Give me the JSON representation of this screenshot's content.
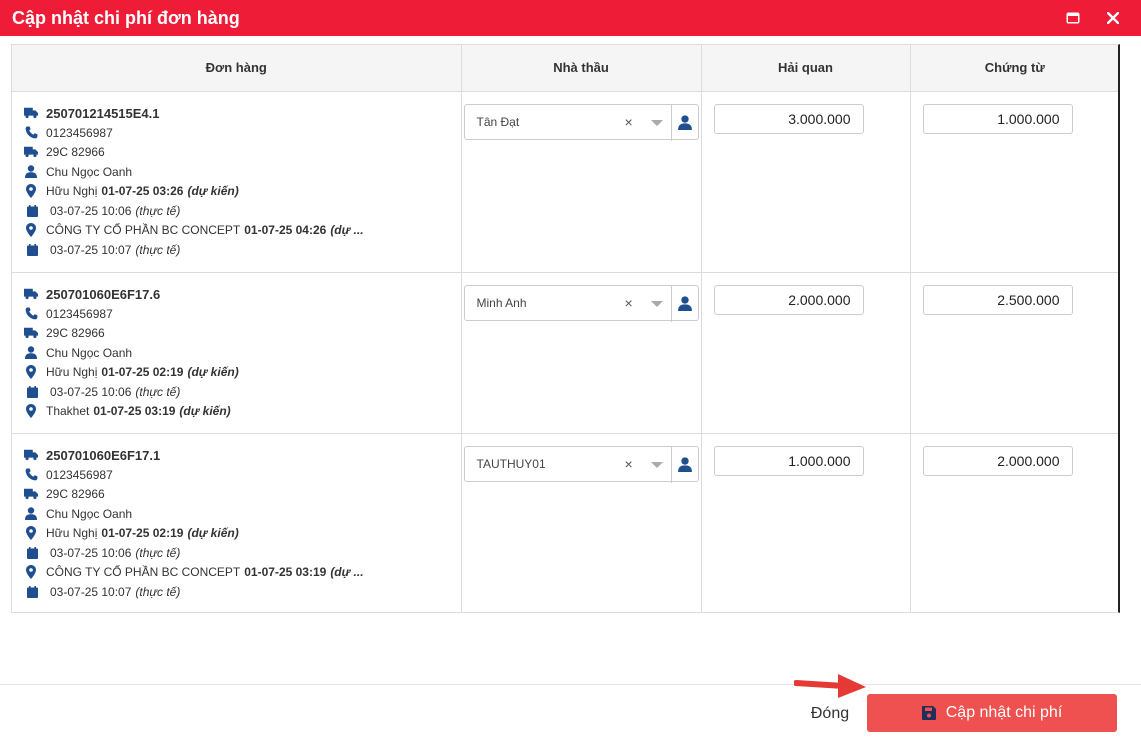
{
  "dialog": {
    "title": "Cập nhật chi phí đơn hàng"
  },
  "table": {
    "headers": [
      "Đơn hàng",
      "Nhà thầu",
      "Hải quan",
      "Chứng từ"
    ]
  },
  "orders": [
    {
      "code": "250701214515E4.1",
      "phone": "0123456987",
      "plate": "29C 82966",
      "driver": "Chu Ngọc Oanh",
      "stops": [
        {
          "place": "Hữu Nghị",
          "planned": "01-07-25 03:26",
          "planned_note": "(dự kiến)",
          "actual": "03-07-25 10:06",
          "actual_note": "(thực tế)"
        },
        {
          "place": "CÔNG TY CỔ PHẦN BC CONCEPT",
          "planned": "01-07-25 04:26",
          "planned_note": "(dự ...",
          "actual": "03-07-25 10:07",
          "actual_note": "(thực tế)"
        }
      ],
      "contractor": "Tân Đạt",
      "customs": "3.000.000",
      "documents": "1.000.000"
    },
    {
      "code": "250701060E6F17.6",
      "phone": "0123456987",
      "plate": "29C 82966",
      "driver": "Chu Ngọc Oanh",
      "stops": [
        {
          "place": "Hữu Nghị",
          "planned": "01-07-25 02:19",
          "planned_note": "(dự kiến)",
          "actual": "03-07-25 10:06",
          "actual_note": "(thực tế)"
        },
        {
          "place": "Thakhet",
          "planned": "01-07-25 03:19",
          "planned_note": "(dự kiến)"
        }
      ],
      "contractor": "Minh Anh",
      "customs": "2.000.000",
      "documents": "2.500.000"
    },
    {
      "code": "250701060E6F17.1",
      "phone": "0123456987",
      "plate": "29C 82966",
      "driver": "Chu Ngọc Oanh",
      "stops": [
        {
          "place": "Hữu Nghị",
          "planned": "01-07-25 02:19",
          "planned_note": "(dự kiến)",
          "actual": "03-07-25 10:06",
          "actual_note": "(thực tế)"
        },
        {
          "place": "CÔNG TY CỔ PHẦN BC CONCEPT",
          "planned": "01-07-25 03:19",
          "planned_note": "(dự ...",
          "actual": "03-07-25 10:07",
          "actual_note": "(thực tế)"
        }
      ],
      "contractor": "TAUTHUY01",
      "customs": "1.000.000",
      "documents": "2.000.000"
    }
  ],
  "select": {
    "clear_glyph": "×"
  },
  "footer": {
    "close_label": "Đóng",
    "update_label": "Cập nhật chi phí"
  },
  "colors": {
    "titlebar": "#ee1c37",
    "icon_blue": "#1f4f8f",
    "primary_button": "#ef5050",
    "arrow": "#e53935"
  },
  "icons": [
    "truck-icon",
    "phone-icon",
    "user-icon",
    "map-marker-icon",
    "calendar-icon",
    "save-icon",
    "restore-window-icon",
    "close-icon"
  ]
}
